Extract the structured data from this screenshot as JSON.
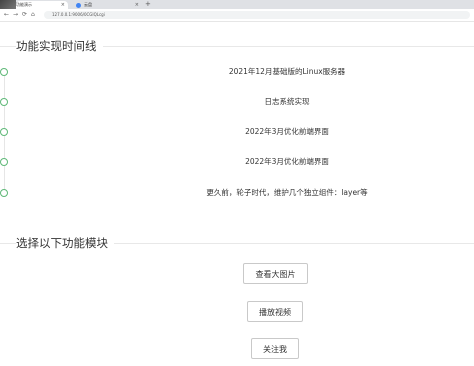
{
  "browser": {
    "tabs": [
      {
        "title": "功能演示",
        "active": true
      },
      {
        "title": "云盘",
        "active": false
      }
    ],
    "close_glyph": "×",
    "new_tab_glyph": "+",
    "nav": {
      "back": "←",
      "forward": "→",
      "reload": "⟳",
      "home": "⌂"
    },
    "url": "127.0.0.1:9006/0CGIQLcgi"
  },
  "timeline": {
    "title": "功能实现时间线",
    "items": [
      "2021年12月基础版的Linux服务器",
      "日志系统实现",
      "2022年3月优化前端界面",
      "2022年3月优化前端界面",
      "更久前，轮子时代，维护几个独立组件：layer等"
    ],
    "dot_color": "#5fb878"
  },
  "modules": {
    "title": "选择以下功能模块",
    "buttons": [
      "查看大图片",
      "播放视频",
      "关注我"
    ]
  }
}
